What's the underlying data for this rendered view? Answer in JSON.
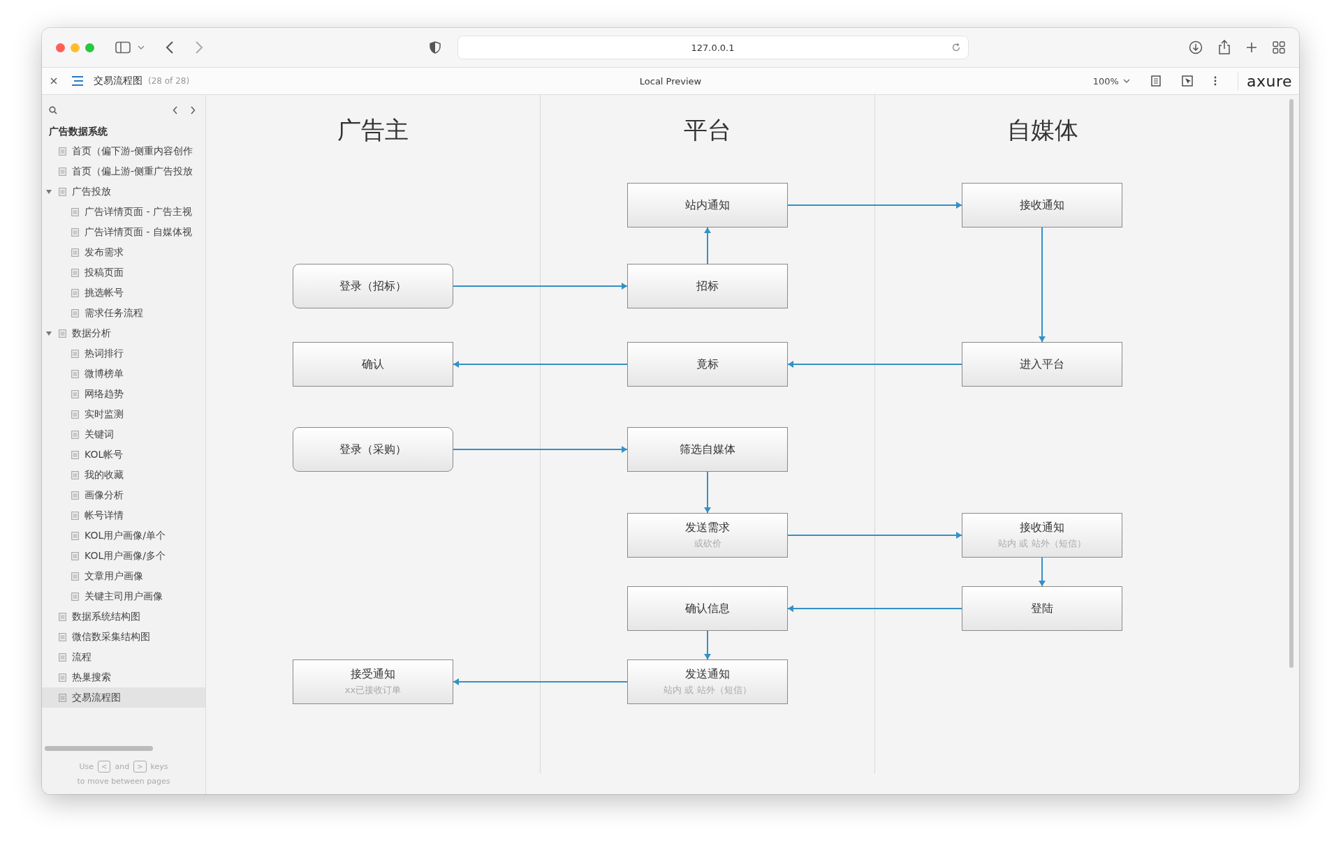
{
  "browser": {
    "url": "127.0.0.1"
  },
  "toolbar": {
    "page_title": "交易流程图",
    "page_count": "(28 of 28)",
    "center_label": "Local Preview",
    "zoom": "100%",
    "logo": "axure"
  },
  "sidebar": {
    "title": "广告数据系统",
    "items": [
      {
        "label": "首页（偏下游-侧重内容创作",
        "selected": false
      },
      {
        "label": "首页（偏上游-侧重广告投放",
        "selected": false
      },
      {
        "label": "广告投放",
        "selected": false,
        "expanded": true,
        "children": [
          {
            "label": "广告详情页面 - 广告主视",
            "selected": false
          },
          {
            "label": "广告详情页面 - 自媒体视",
            "selected": false
          },
          {
            "label": "发布需求",
            "selected": false
          },
          {
            "label": "投稿页面",
            "selected": false
          },
          {
            "label": "挑选帐号",
            "selected": false
          },
          {
            "label": "需求任务流程",
            "selected": false
          }
        ]
      },
      {
        "label": "数据分析",
        "selected": false,
        "expanded": true,
        "children": [
          {
            "label": "热词排行",
            "selected": false
          },
          {
            "label": "微博榜单",
            "selected": false
          },
          {
            "label": "网络趋势",
            "selected": false
          },
          {
            "label": "实时监测",
            "selected": false
          },
          {
            "label": "关键词",
            "selected": false
          },
          {
            "label": "KOL帐号",
            "selected": false
          },
          {
            "label": "我的收藏",
            "selected": false
          },
          {
            "label": "画像分析",
            "selected": false
          },
          {
            "label": "帐号详情",
            "selected": false
          },
          {
            "label": "KOL用户画像/单个",
            "selected": false
          },
          {
            "label": "KOL用户画像/多个",
            "selected": false
          },
          {
            "label": "文章用户画像",
            "selected": false
          },
          {
            "label": "关键主司用户画像",
            "selected": false
          }
        ]
      },
      {
        "label": "数据系统结构图",
        "selected": false
      },
      {
        "label": "微信数采集结构图",
        "selected": false
      },
      {
        "label": "流程",
        "selected": false
      },
      {
        "label": "热巢搜索",
        "selected": false
      },
      {
        "label": "交易流程图",
        "selected": true
      }
    ],
    "hint": {
      "use": "Use",
      "prev_key": "<",
      "and": "and",
      "next_key": ">",
      "keys": "keys",
      "line2": "to move between pages"
    }
  },
  "diagram": {
    "lanes": [
      {
        "title": "广告主"
      },
      {
        "title": "平台"
      },
      {
        "title": "自媒体"
      }
    ],
    "rows": [
      [
        null,
        {
          "label": "站内通知",
          "kind": "process",
          "arrow_right": true
        },
        {
          "label": "接收通知",
          "kind": "process",
          "arrow_down": true
        }
      ],
      [
        {
          "label": "登录（招标）",
          "kind": "start",
          "arrow_right": true
        },
        {
          "label": "招标",
          "kind": "process",
          "arrow_up": true
        },
        null
      ],
      [
        {
          "label": "确认",
          "kind": "process"
        },
        {
          "label": "竟标",
          "kind": "process",
          "arrow_left": true
        },
        {
          "label": "进入平台",
          "kind": "process",
          "arrow_left": true
        }
      ],
      [
        {
          "label": "登录（采购）",
          "kind": "start",
          "arrow_right": true
        },
        {
          "label": "筛选自媒体",
          "kind": "process",
          "arrow_down": true
        },
        null
      ],
      [
        null,
        {
          "label": "发送需求",
          "sub": "或砍价",
          "kind": "process",
          "arrow_right": true
        },
        {
          "label": "接收通知",
          "sub": "站内 或 站外（短信）",
          "kind": "process",
          "arrow_down": true
        }
      ],
      [
        null,
        {
          "label": "确认信息",
          "kind": "process",
          "arrow_down": true
        },
        {
          "label": "登陆",
          "kind": "process",
          "arrow_left": true
        }
      ],
      [
        {
          "label": "接受通知",
          "sub": "xx已接收订单",
          "kind": "process"
        },
        {
          "label": "发送通知",
          "sub": "站内 或 站外（短信）",
          "kind": "process",
          "arrow_left": true
        },
        null
      ]
    ]
  }
}
